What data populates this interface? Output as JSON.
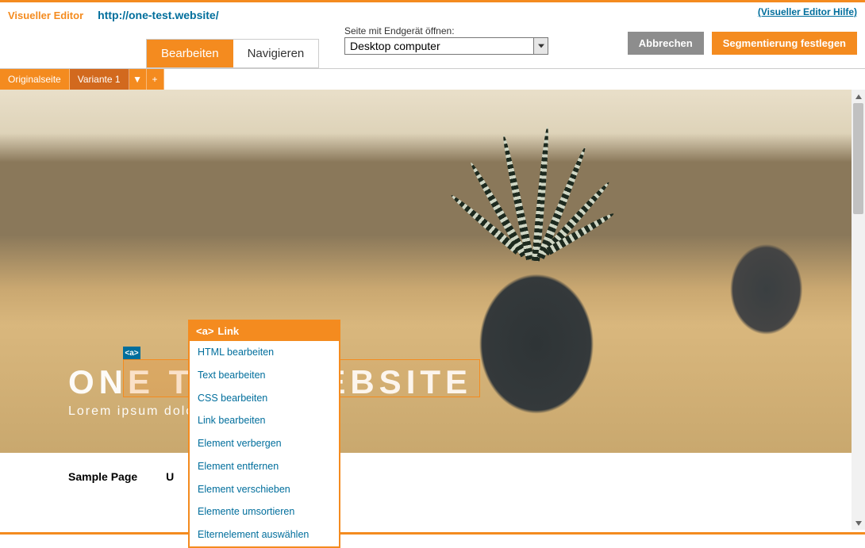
{
  "header": {
    "editor_label": "Visueller Editor",
    "url": "http://one-test.website/",
    "help_link": "(Visueller Editor Hilfe)"
  },
  "modes": {
    "edit": "Bearbeiten",
    "navigate": "Navigieren"
  },
  "device": {
    "label": "Seite mit Endgerät öffnen:",
    "selected": "Desktop computer"
  },
  "actions": {
    "cancel": "Abbrechen",
    "segment": "Segmentierung festlegen"
  },
  "variants": {
    "original": "Originalseite",
    "v1": "Variante 1",
    "dd": "▼",
    "plus": "+"
  },
  "hero": {
    "title": "ONE TEST WEBSITE",
    "subtitle": "Lorem ipsum dolor s",
    "badge": "<a>"
  },
  "nav": {
    "item1": "Sample Page",
    "item2": "U"
  },
  "context": {
    "header_tag": "<a>",
    "header_label": "Link",
    "items": [
      "HTML bearbeiten",
      "Text bearbeiten",
      "CSS bearbeiten",
      "Link bearbeiten",
      "Element verbergen",
      "Element entfernen",
      "Element verschieben",
      "Elemente umsortieren",
      "Elternelement auswählen"
    ]
  }
}
